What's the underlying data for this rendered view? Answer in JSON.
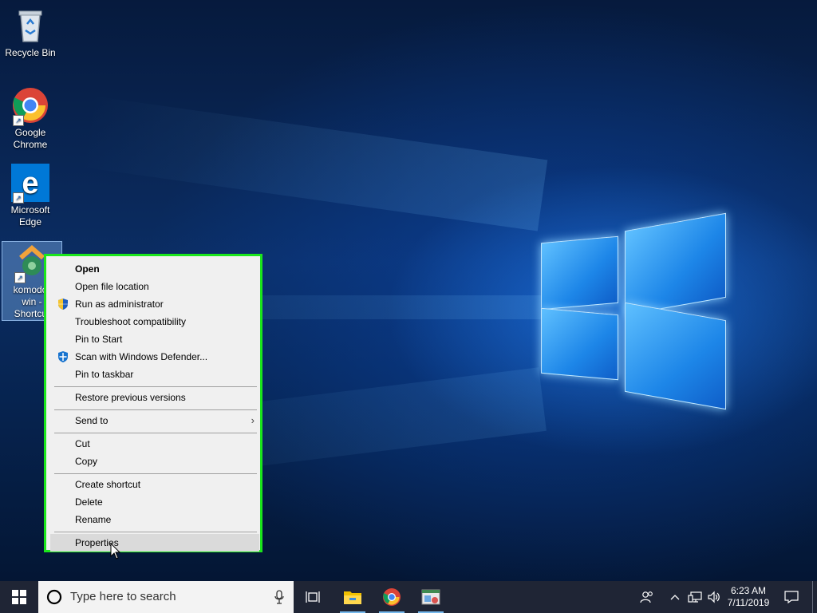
{
  "desktop": {
    "icons": [
      {
        "label": "Recycle Bin",
        "icon": "recycle-bin-icon"
      },
      {
        "label": "Google Chrome",
        "icon": "chrome-icon"
      },
      {
        "label": "Microsoft Edge",
        "icon": "edge-icon"
      },
      {
        "label": "komodo-win - Shortcut",
        "label_lines": [
          "komodo-",
          "win -",
          "Shortcut"
        ],
        "icon": "komodo-icon"
      }
    ]
  },
  "context_menu": {
    "highlight_color": "#1be61b",
    "items": [
      {
        "label": "Open",
        "bold": true
      },
      {
        "label": "Open file location"
      },
      {
        "label": "Run as administrator",
        "icon": "uac-shield-icon"
      },
      {
        "label": "Troubleshoot compatibility"
      },
      {
        "label": "Pin to Start"
      },
      {
        "label": "Scan with Windows Defender...",
        "icon": "defender-icon"
      },
      {
        "label": "Pin to taskbar"
      },
      {
        "label": "Restore previous versions"
      },
      {
        "label": "Send to",
        "submenu": true
      },
      {
        "label": "Cut"
      },
      {
        "label": "Copy"
      },
      {
        "label": "Create shortcut"
      },
      {
        "label": "Delete"
      },
      {
        "label": "Rename"
      },
      {
        "label": "Properties",
        "hovered": true
      }
    ]
  },
  "taskbar": {
    "search_placeholder": "Type here to search",
    "apps": [
      "task-view-icon",
      "file-explorer-icon",
      "chrome-icon",
      "app-icon"
    ],
    "clock": {
      "time": "6:23 AM",
      "date": "7/11/2019"
    },
    "colors": {
      "taskbar": "#1f2535",
      "accent": "#76b9ed"
    }
  }
}
